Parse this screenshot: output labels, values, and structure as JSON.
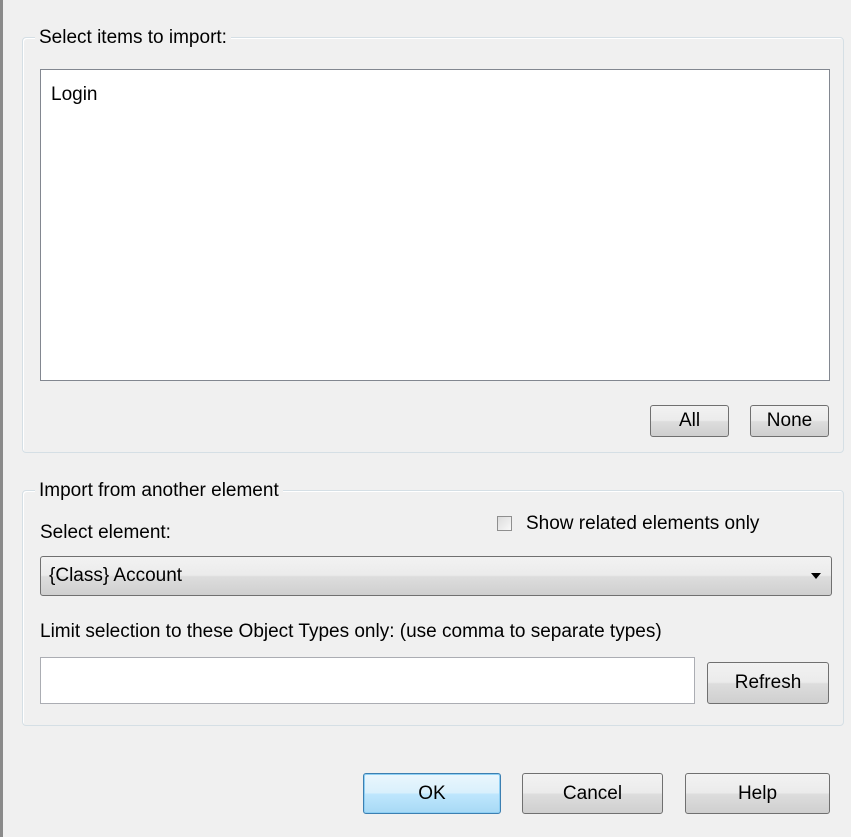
{
  "import_items": {
    "legend": "Select items to import:",
    "list_items": [
      "Login"
    ],
    "all_label": "All",
    "none_label": "None"
  },
  "import_from": {
    "legend": "Import from another element",
    "select_element_label": "Select element:",
    "show_related_label": "Show related elements only",
    "show_related_checked": false,
    "selected_element": "{Class} Account",
    "limit_label": "Limit selection to these Object Types only: (use comma to separate types)",
    "object_types_value": "",
    "refresh_label": "Refresh"
  },
  "footer": {
    "ok_label": "OK",
    "cancel_label": "Cancel",
    "help_label": "Help"
  },
  "icons": {
    "dropdown": "chevron-down-icon",
    "checkbox": "checkbox-unchecked"
  }
}
